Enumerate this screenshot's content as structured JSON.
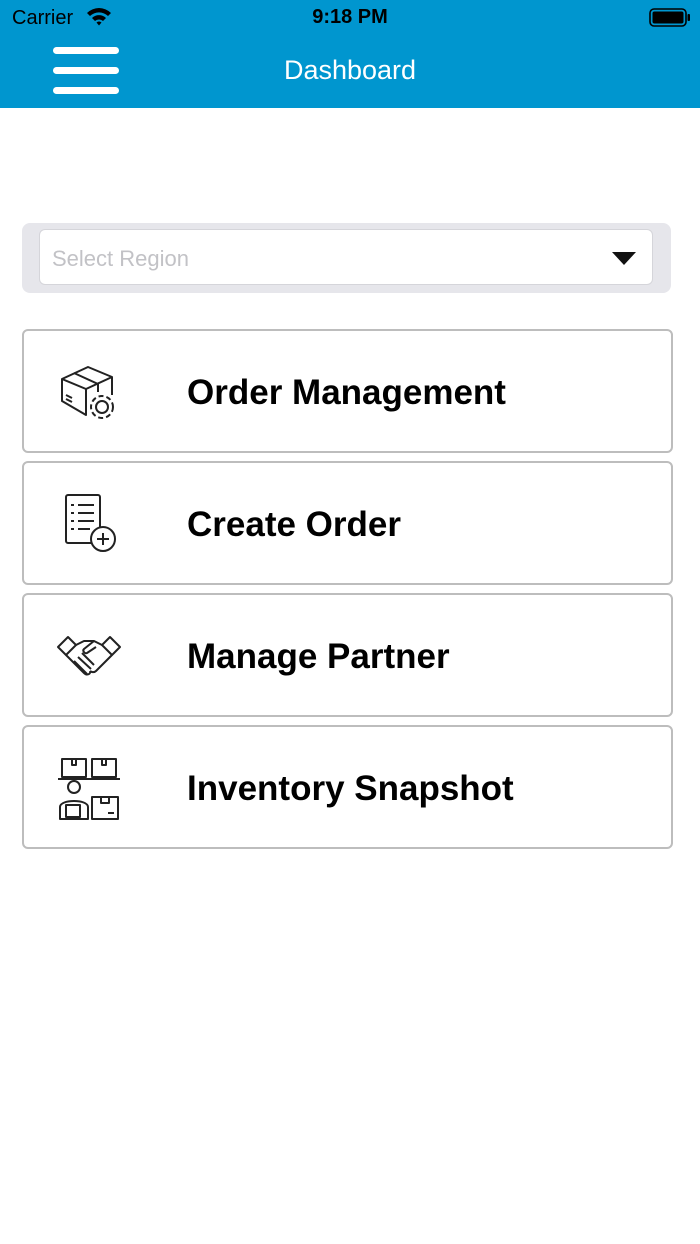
{
  "status_bar": {
    "carrier": "Carrier",
    "time": "9:18 PM"
  },
  "header": {
    "title": "Dashboard",
    "bg_color": "#0096cf",
    "menu_icon": "hamburger-icon"
  },
  "region": {
    "placeholder": "Select Region",
    "dropdown_icon": "caret-down-icon"
  },
  "menu": [
    {
      "label": "Order Management",
      "icon": "box-gear-icon"
    },
    {
      "label": "Create Order",
      "icon": "checklist-add-icon"
    },
    {
      "label": "Manage Partner",
      "icon": "handshake-icon"
    },
    {
      "label": "Inventory Snapshot",
      "icon": "warehouse-worker-icon"
    }
  ]
}
